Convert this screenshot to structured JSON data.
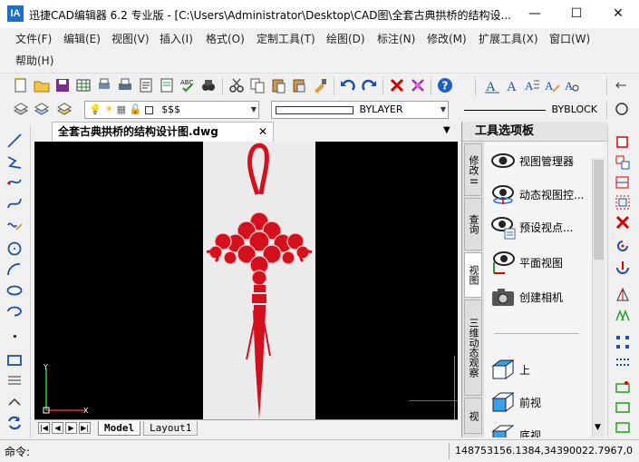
{
  "window": {
    "app_icon_text": "IA",
    "title": "迅捷CAD编辑器 6.2 专业版  - [C:\\Users\\Administrator\\Desktop\\CAD图\\全套古典拱桥的结构设...",
    "minimize": "—",
    "maximize": "☐",
    "close": "✕"
  },
  "menu": {
    "row1": [
      "文件(F)",
      "编辑(E)",
      "视图(V)",
      "插入(I)",
      "格式(O)",
      "定制工具(T)",
      "绘图(D)",
      "标注(N)",
      "修改(M)",
      "扩展工具(X)",
      "窗口(W)"
    ],
    "row2": [
      "帮助(H)"
    ]
  },
  "toolbar2": {
    "layer_value": "$$$",
    "linetype_value": "BYLAYER",
    "lineweight_value": "BYBLOCK"
  },
  "document": {
    "tab_title": "全套古典拱桥的结构设计图.dwg",
    "tab_close": "✕",
    "tab_menu": "▼"
  },
  "sheets": {
    "tabs": [
      "Model",
      "Layout1"
    ]
  },
  "palette": {
    "title": "工具选项板",
    "side_tabs": [
      "修改 II",
      "查询",
      "视图",
      "三维动态观察",
      "视"
    ],
    "tools": [
      {
        "label": "视图管理器",
        "icon": "eye-icon"
      },
      {
        "label": "动态视图控...",
        "icon": "eye-orbit-icon"
      },
      {
        "label": "预设视点...",
        "icon": "eye-viewpoint-icon"
      },
      {
        "label": "平面视图",
        "icon": "eye-plan-icon"
      },
      {
        "label": "创建相机",
        "icon": "camera-icon"
      },
      {
        "label": "上",
        "icon": "cube-top-icon"
      },
      {
        "label": "前视",
        "icon": "cube-front-icon"
      },
      {
        "label": "底视",
        "icon": "cube-bottom-icon"
      }
    ]
  },
  "status": {
    "command_label": "命令:",
    "coordinates": "148753156.1384,34390022.7967,0"
  },
  "colors": {
    "knot_red": "#d4101e",
    "canvas": "#000000",
    "paper": "#ebebeb"
  }
}
